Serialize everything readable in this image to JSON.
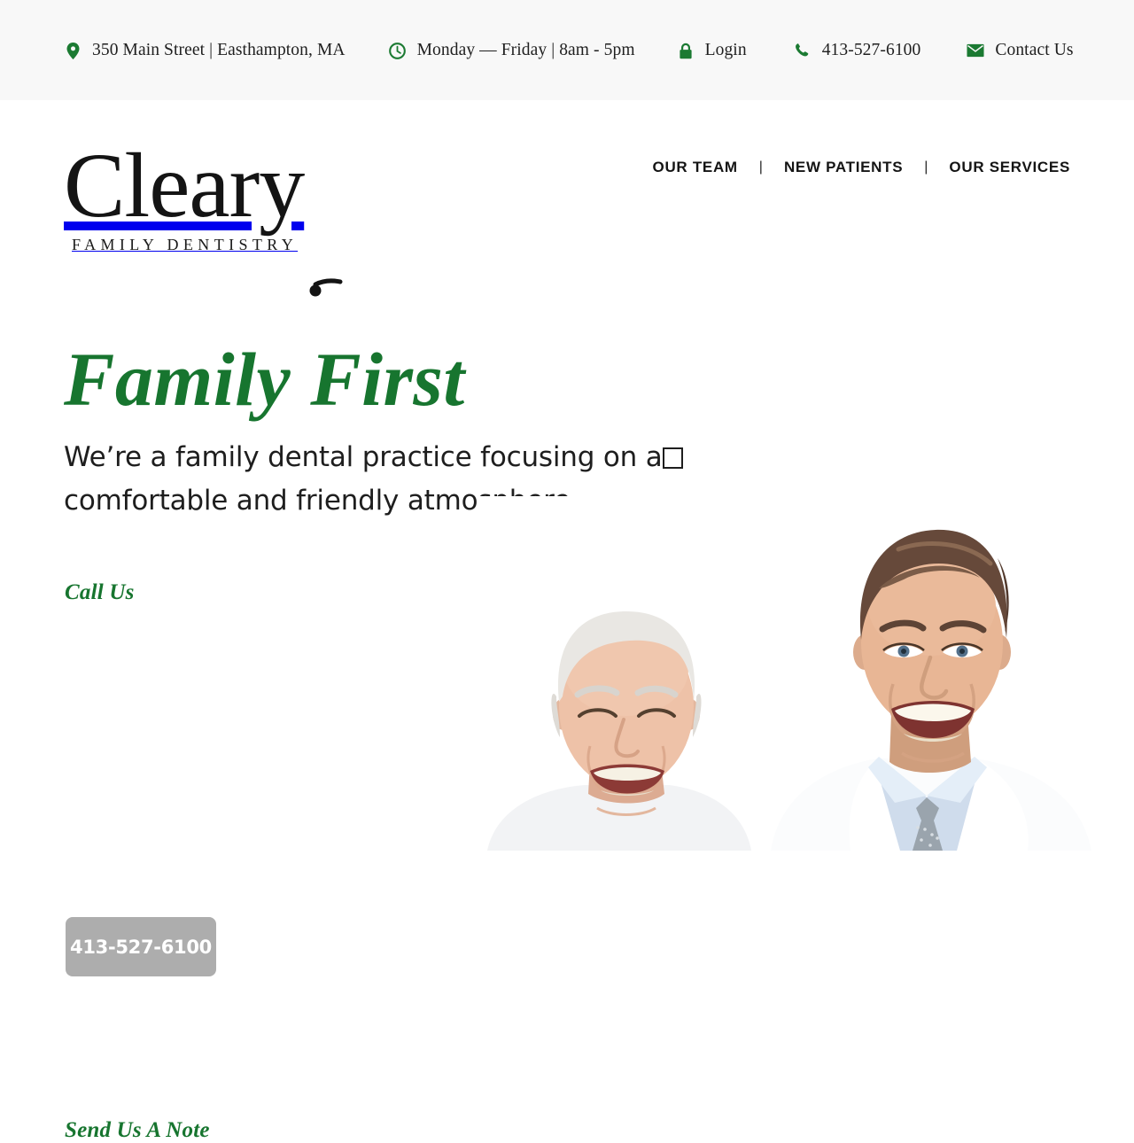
{
  "theme": {
    "green": "#17752f",
    "ink": "#141414",
    "topbar_bg": "#f8f8f8",
    "button_gray": "#adadad",
    "page_bg": "#ffffff"
  },
  "topbar": {
    "items": [
      {
        "icon": "map-pin-icon",
        "text": "350 Main Street | Easthampton, MA"
      },
      {
        "icon": "clock-icon",
        "text": "Monday — Friday | 8am - 5pm"
      },
      {
        "icon": "lock-icon",
        "text": "Login"
      },
      {
        "icon": "phone-icon",
        "text": "413-527-6100"
      },
      {
        "icon": "envelope-icon",
        "text": "Contact Us"
      }
    ]
  },
  "logo": {
    "word": "Cleary",
    "sub": "FAMILY DENTISTRY"
  },
  "nav": {
    "items": [
      {
        "label": "OUR TEAM"
      },
      {
        "label": "NEW PATIENTS"
      },
      {
        "label": "OUR SERVICES"
      }
    ],
    "separator": "|"
  },
  "hero": {
    "title": "Family First",
    "subtitle_line1_a": "We’re a family dental practice focusing on a",
    "subtitle_line1_b": "",
    "subtitle_line2": "comfortable and friendly atmosphere.",
    "call_us_label": "Call Us",
    "phone_button": "413-527-6100",
    "note_label": "Send Us A Note",
    "photo_alt": "two-dentists-photo"
  }
}
